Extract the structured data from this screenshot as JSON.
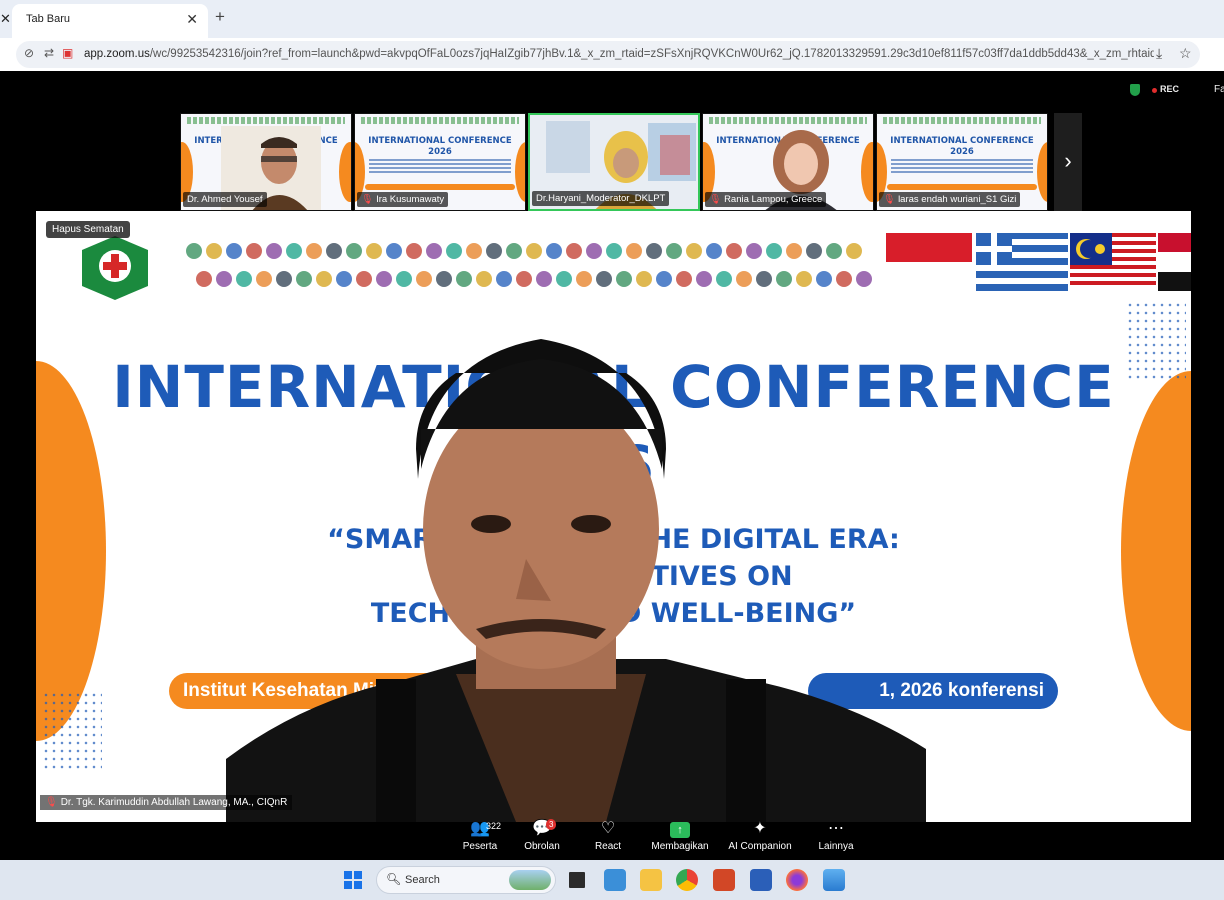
{
  "browser": {
    "tab_title": "Tab Baru",
    "tab_close": "✕",
    "new_tab": "+",
    "url_host": "app.zoom.us",
    "url_rest": "/wc/99253542316/join?ref_from=launch&pwd=akvpqOfFaL0ozs7jqHaIZgib77jhBv.1&_x_zm_rtaid=zSFsXnjRQVKCnW0Ur62_jQ.1782013329591.29c3d10ef811f57c03ff7da1ddb5dd43&_x_zm_rhtaid=1"
  },
  "zoom": {
    "rec_label": "REC",
    "cut_label": "Fa",
    "thumbnails": [
      {
        "name": "Dr. Ahmed Yousef",
        "type": "person",
        "mic_muted": false
      },
      {
        "name": "Ira Kusumawaty",
        "type": "slide",
        "mic_muted": true
      },
      {
        "name": "Dr.Haryani_Moderator_DKLPT",
        "type": "person",
        "mic_muted": false,
        "active": true
      },
      {
        "name": "Rania Lampou, Greece",
        "type": "person",
        "mic_muted": true
      },
      {
        "name": "laras endah wuriani_S1 Gizi",
        "type": "slide",
        "mic_muted": true
      }
    ],
    "thumb_slide_title": "INTERNATIONAL CONFERENCE",
    "thumb_slide_year": "2026",
    "pin_label": "Hapus Sematan",
    "slide": {
      "title": "INTERNATIONAL CONFERENCE",
      "year": "26",
      "sub1": "“SMART AND                        NG IN THE DIGITAL ERA:",
      "sub2": "MULTI                      ERSPECTIVES ON",
      "sub3": "TECHNOL                          TY, AND WELL-BEING”",
      "pill_left": "Institut Kesehatan Mit",
      "pill_right": "1, 2026  konferensi"
    },
    "speaker_name": "Dr. Tgk. Karimuddin Abdullah Lawang, MA., CIQnR",
    "controls": [
      {
        "label": "Peserta",
        "icon": "participants-icon",
        "glyph": "👥",
        "count": "322"
      },
      {
        "label": "Obrolan",
        "icon": "chat-icon",
        "glyph": "💬",
        "badge": "3"
      },
      {
        "label": "React",
        "icon": "heart-icon",
        "glyph": "♡"
      },
      {
        "label": "Membagikan",
        "icon": "share-icon",
        "glyph": "↑"
      },
      {
        "label": "AI Companion",
        "icon": "sparkle-icon",
        "glyph": "✦"
      },
      {
        "label": "Lainnya",
        "icon": "more-icon",
        "glyph": "⋯"
      }
    ],
    "colors": {
      "accent_blue": "#1e5bb8",
      "accent_orange": "#f58a1f",
      "active_green": "#34c759"
    }
  },
  "taskbar": {
    "search_placeholder": "Search",
    "apps": [
      "task-view-icon",
      "notepad-icon",
      "file-explorer-icon",
      "chrome-icon",
      "powerpoint-icon",
      "word-icon",
      "firefox-icon",
      "photos-icon"
    ]
  }
}
